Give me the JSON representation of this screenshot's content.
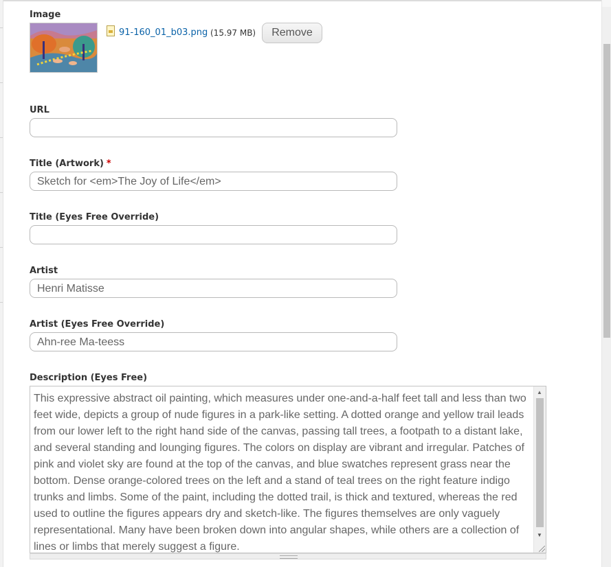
{
  "image_field": {
    "label": "Image",
    "file_name": "91-160_01_b03.png",
    "file_size": "(15.97 MB)",
    "remove_label": "Remove"
  },
  "url_field": {
    "label": "URL",
    "value": ""
  },
  "title_artwork": {
    "label": "Title (Artwork)",
    "required_marker": "*",
    "value": "Sketch for <em>The Joy of Life</em>"
  },
  "title_eyes_free": {
    "label": "Title (Eyes Free Override)",
    "value": ""
  },
  "artist": {
    "label": "Artist",
    "value": "Henri Matisse"
  },
  "artist_eyes_free": {
    "label": "Artist (Eyes Free Override)",
    "value": "Ahn-ree Ma-teess"
  },
  "description": {
    "label": "Description (Eyes Free)",
    "value": "This expressive abstract oil painting, which measures under one-and-a-half feet tall and less than two feet wide, depicts a group of nude figures in a park-like setting. A dotted orange and yellow trail leads from our lower left to the right hand side of the canvas, passing tall trees, a footpath to a distant lake, and several standing and lounging figures. The colors on display are vibrant and irregular. Patches of pink and violet sky are found at the top of the canvas, and blue swatches represent grass near the bottom. Dense orange-colored trees on the left and a stand of teal trees on the right feature indigo trunks and limbs. Some of the paint, including the dotted trail, is thick and textured, whereas the red used to outline the figures appears dry and sketch-like. The figures themselves are only vaguely representational. Many have been broken down into angular shapes, while others are a collection of lines or limbs that merely suggest a figure."
  },
  "icons": {
    "file": "image-file-icon",
    "scroll_up": "scroll-up-arrow-icon",
    "scroll_down": "scroll-down-arrow-icon",
    "resize": "resize-handle-icon"
  },
  "colors": {
    "link": "#0a62a8",
    "required": "#cc0000",
    "field_border": "#b9b9b9"
  }
}
